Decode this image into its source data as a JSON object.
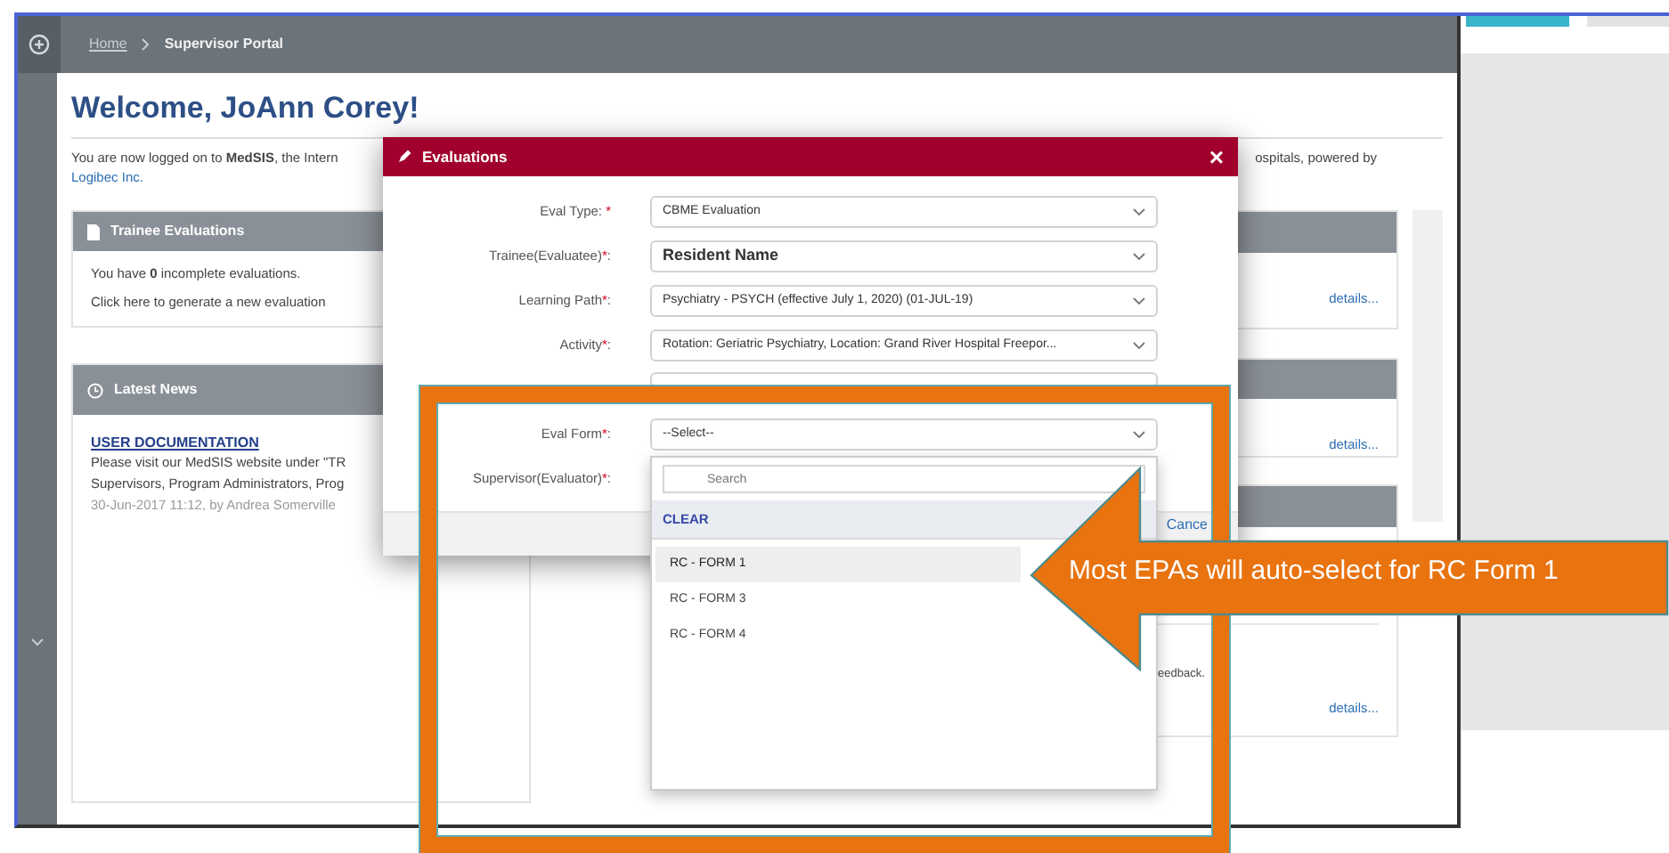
{
  "breadcrumb": [
    "Home",
    "Supervisor Portal"
  ],
  "welcome_title": "Welcome, JoAnn Corey!",
  "intro": {
    "left": "You are now logged on to **MedSIS**, the Intern",
    "right": "ospitals, powered by",
    "link": "Logibec Inc."
  },
  "trainee_card": {
    "title": "Trainee Evaluations",
    "lines": [
      "You have **0** incomplete evaluations.",
      "Click here to generate a new evaluation"
    ]
  },
  "news_card": {
    "title": "Latest News",
    "headline": "USER DOCUMENTATION",
    "lines": [
      "Please visit our MedSIS website under \"TR",
      "Supervisors, Program Administrators, Prog"
    ],
    "meta": "30-Jun-2017 11:12, by Andrea Somerville"
  },
  "side_cards": [
    {
      "link": "details..."
    },
    {
      "link": "details..."
    },
    {
      "text": "eedback.",
      "link": "details..."
    }
  ],
  "modal": {
    "title": "Evaluations",
    "close": "×",
    "footer_link": "Cance",
    "fields": [
      {
        "kind": "select",
        "label": "Eval Type: ",
        "mark": "*",
        "value": "CBME Evaluation"
      },
      {
        "kind": "name",
        "label": "Trainee(Evaluatee)",
        "mark": "*",
        "after": ":",
        "value": "Resident Name"
      },
      {
        "kind": "select",
        "label": "Learning Path",
        "mark": "*",
        "after": ":",
        "value": "Psychiatry - PSYCH (effective July 1, 2020) (01-JUL-19)"
      },
      {
        "kind": "select",
        "label": "Activity",
        "mark": "*",
        "after": ":",
        "value": "Rotation: Geriatric Psychiatry, Location: Grand River Hospital Freepor..."
      },
      {
        "kind": "covered"
      },
      {
        "kind": "select",
        "label": "Eval Form",
        "mark": "*",
        "after": ":",
        "value": "--Select--"
      },
      {
        "kind": "label",
        "label": "Supervisor(Evaluator)",
        "mark": "*",
        "after": ":"
      }
    ]
  },
  "dropdown": {
    "placeholder": "Search",
    "clear": "CLEAR",
    "options": [
      {
        "label": "RC - FORM 1",
        "selected": true
      },
      {
        "label": "RC - FORM 3",
        "selected": false
      },
      {
        "label": "RC - FORM 4",
        "selected": false
      }
    ]
  },
  "callout": {
    "text": "Most EPAs will auto-select for RC Form 1"
  }
}
